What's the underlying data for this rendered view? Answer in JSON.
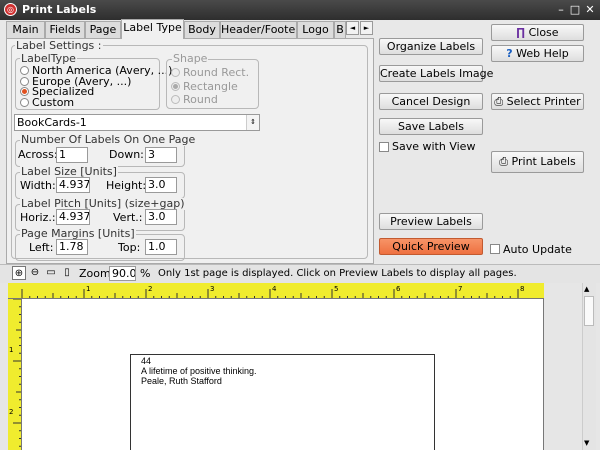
{
  "window": {
    "title": "Print Labels",
    "minimize": "–",
    "maximize": "□",
    "close": "✕"
  },
  "tabs": [
    "Main",
    "Fields",
    "Page",
    "Label Type",
    "Body",
    "Header/Footer",
    "Logo",
    "B"
  ],
  "tab_nav": {
    "left": "◄",
    "right": "►"
  },
  "label_settings": {
    "title": "Label Settings :",
    "label_type": {
      "title": "LabelType",
      "options": [
        "North America (Avery, ...)",
        "Europe (Avery, ...)",
        "Specialized",
        "Custom"
      ],
      "selected": "Specialized"
    },
    "shape": {
      "title": "Shape",
      "options": [
        "Round Rect.",
        "Rectangle",
        "Round"
      ],
      "selected": "Rectangle"
    },
    "label_name": "BookCards-1",
    "number_on_page": {
      "title": "Number Of Labels On One Page",
      "across_label": "Across:",
      "across": "1",
      "down_label": "Down:",
      "down": "3"
    },
    "label_size": {
      "title": "Label Size [Units]",
      "width_label": "Width:",
      "width": "4.9375",
      "height_label": "Height:",
      "height": "3.0"
    },
    "label_pitch": {
      "title": "Label Pitch [Units] (size+gap)",
      "horiz_label": "Horiz.:",
      "horiz": "4.9375",
      "vert_label": "Vert.:",
      "vert": "3.0"
    },
    "page_margins": {
      "title": "Page Margins [Units]",
      "left_label": "Left:",
      "left": "1.78",
      "top_label": "Top:",
      "top": "1.0"
    }
  },
  "buttons": {
    "organize": "Organize Labels",
    "create_image": "Create Labels Image",
    "cancel": "Cancel Design",
    "save": "Save Labels",
    "save_with_view": "Save with View",
    "preview": "Preview Labels",
    "quick_preview": "Quick Preview",
    "auto_update": "Auto Update",
    "close": "Close",
    "web_help": "Web Help",
    "select_printer": "Select Printer",
    "print_labels": "Print Labels"
  },
  "toolbar": {
    "zoom_label": "Zoom",
    "zoom_value": "90.0",
    "zoom_unit": "%",
    "info": "Only 1st page is displayed. Click on Preview Labels to display all pages."
  },
  "ruler": {
    "h_numbers": [
      "1",
      "2",
      "3",
      "4",
      "5",
      "6",
      "7",
      "8"
    ],
    "v_numbers": [
      "1",
      "2"
    ]
  },
  "label_preview": {
    "line1": "44",
    "line2": "A lifetime of positive thinking.",
    "line3": "Peale, Ruth Stafford"
  },
  "colors": {
    "accent_orange": "#ee7040",
    "ruler_yellow": "#f0ec2e",
    "radio_selected": "#e05020"
  }
}
